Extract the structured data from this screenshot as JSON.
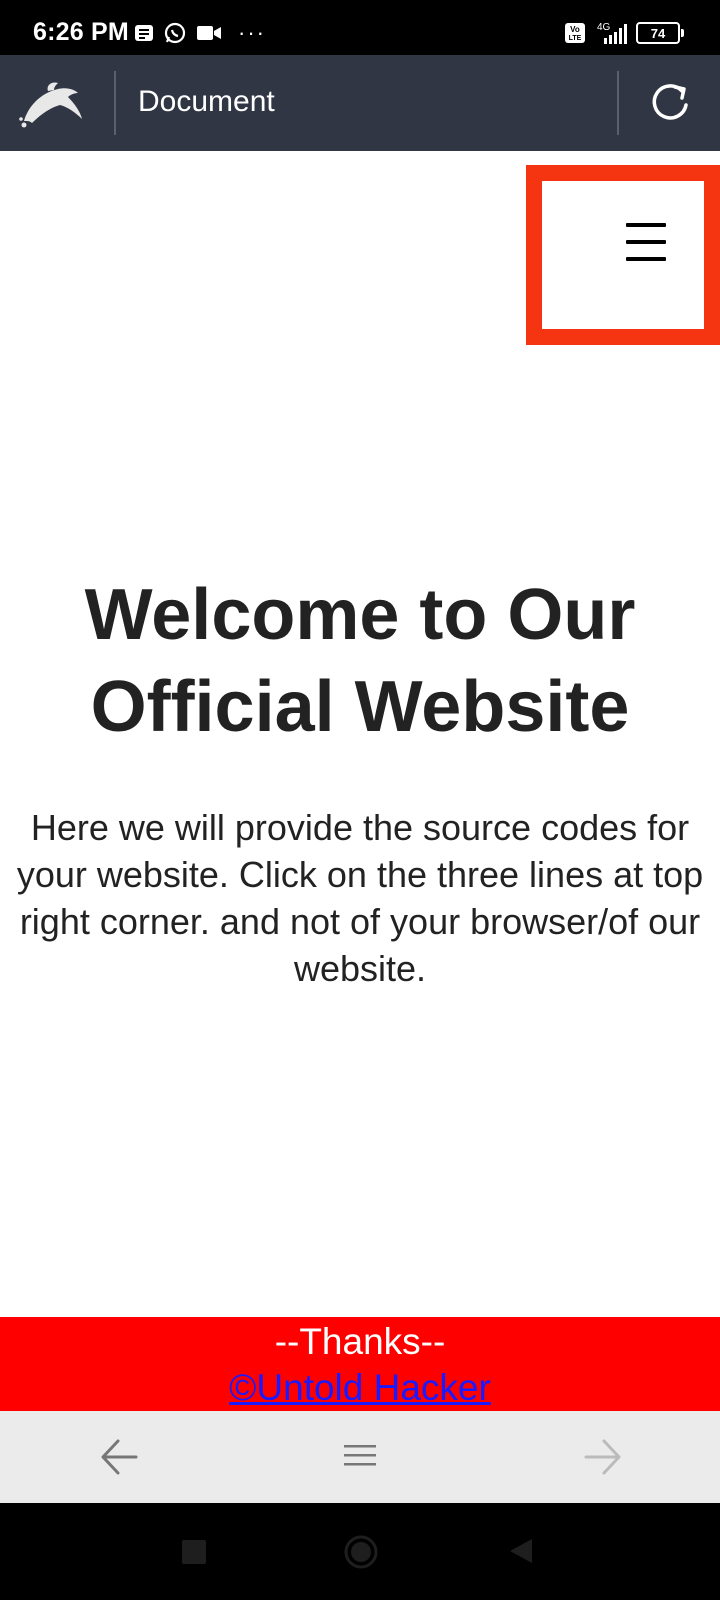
{
  "status_bar": {
    "time": "6:26 PM",
    "dots": "···",
    "network": "4G",
    "volte": "Vo LTE",
    "battery": "74"
  },
  "toolbar": {
    "title": "Document",
    "logo_icon": "dolphin-icon",
    "reload_icon": "reload-icon"
  },
  "page": {
    "menu_icon": "hamburger-icon",
    "title": "Welcome to Our Official Website",
    "intro": "Here we will provide the source codes for your website. Click on the three lines at top right corner. and not of your browser/of our website.",
    "footer_thanks": "--Thanks--",
    "footer_link": "©Untold Hacker"
  },
  "browser_nav": {
    "back_icon": "arrow-left-icon",
    "menu_icon": "menu-icon",
    "forward_icon": "arrow-right-icon"
  },
  "colors": {
    "toolbar_bg": "#303643",
    "highlight_border": "#f53512",
    "footer_bg": "#ff0000",
    "footer_link": "#1a1aff",
    "text": "#222222"
  }
}
